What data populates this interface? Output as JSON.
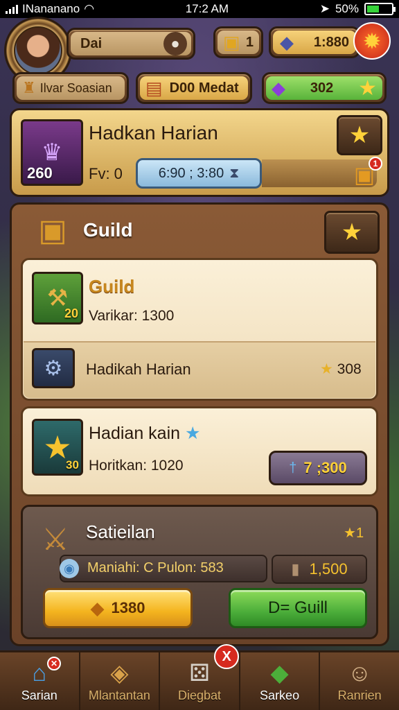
{
  "status_bar": {
    "carrier": "INananano",
    "time": "17:2 AM",
    "battery": "50%"
  },
  "header": {
    "player_name": "Dai",
    "player_subtitle": "Ilvar Soasian",
    "chest_count": "1",
    "gold": "1:880",
    "event_label": "D00 Medat",
    "gems": "302"
  },
  "daily_panel": {
    "title": "Hadkan Harian",
    "level": "260",
    "progress_text": "Fv: 0",
    "timer": "6:90 ; 3:80",
    "badge": "1"
  },
  "guild_panel": {
    "title": "Guild",
    "card1": {
      "title": "Guild",
      "level": "20",
      "subtitle": "Varikar: 1300"
    },
    "card1_row": {
      "title": "Hadikah Harian",
      "value": "308"
    },
    "card2": {
      "title": "Hadian kain",
      "level": "30",
      "subtitle": "Horitkan: 1020",
      "button_value": "7 ;300"
    },
    "card3": {
      "title": "Satieilan",
      "subtitle": "Maniahi: C Pulon: 583",
      "reward_value": "1,500",
      "badge": "1",
      "gold_button": "1380",
      "green_button": "D= Guill"
    }
  },
  "nav": {
    "items": [
      {
        "label": "Sarian",
        "icon": "home-icon"
      },
      {
        "label": "Mlantantan",
        "icon": "shield-icon"
      },
      {
        "label": "Diegbat",
        "icon": "dice-icon"
      },
      {
        "label": "Sarkeo",
        "icon": "ticket-icon"
      },
      {
        "label": "Ranrien",
        "icon": "profile-icon"
      }
    ],
    "alert_badge": "X"
  },
  "colors": {
    "wood": "#5a3a20",
    "parchment": "#f3e2c2",
    "gold": "#f6c22e",
    "green": "#4cae3a",
    "red": "#d62a1e"
  }
}
